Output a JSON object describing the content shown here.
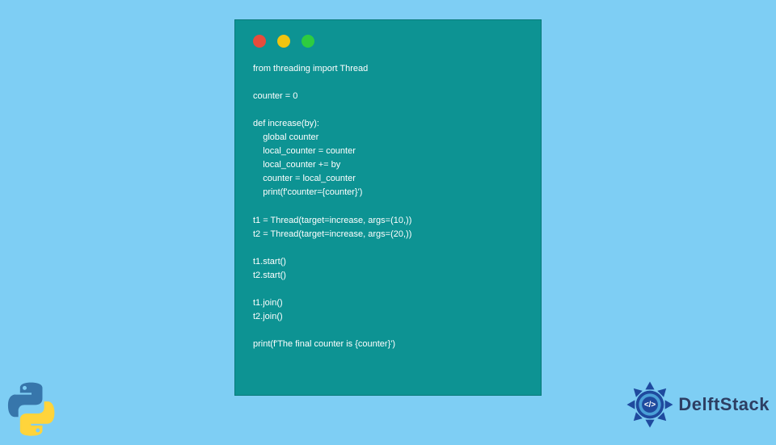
{
  "window": {
    "traffic": [
      "red",
      "yellow",
      "green"
    ]
  },
  "code": {
    "lines": "from threading import Thread\n\ncounter = 0\n\ndef increase(by):\n    global counter\n    local_counter = counter\n    local_counter += by\n    counter = local_counter\n    print(f'counter={counter}')\n\nt1 = Thread(target=increase, args=(10,))\nt2 = Thread(target=increase, args=(20,))\n\nt1.start()\nt2.start()\n\nt1.join()\nt2.join()\n\nprint(f'The final counter is {counter}')"
  },
  "brand": {
    "name": "DelftStack"
  },
  "colors": {
    "background": "#7ecef4",
    "window": "#0d9393",
    "code_text": "#ffffff",
    "brand_text": "#2d3e63",
    "python_blue": "#3776ab",
    "python_yellow": "#ffd43b",
    "delft_blue": "#1f4a9e"
  }
}
